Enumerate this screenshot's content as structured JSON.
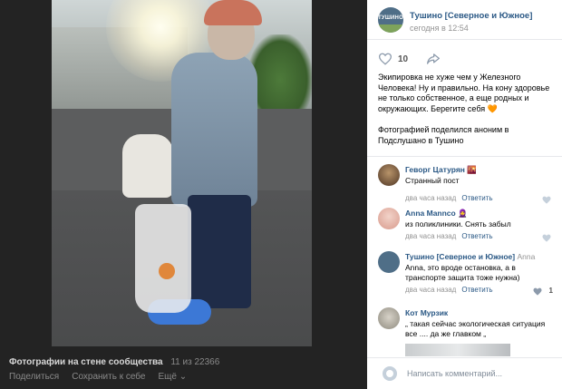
{
  "viewer": {
    "footer_title": "Фотографии на стене сообщества",
    "footer_count": "11 из 22366",
    "actions": [
      "Поделиться",
      "Сохранить к себе",
      "Ещё ⌄"
    ]
  },
  "post": {
    "group_name": "Тушино [Северное и Южное]",
    "avatar_text": "ТУШИНО",
    "time": "сегодня в 12:54",
    "likes": "10",
    "text": "Экипировка не хуже чем у Железного Человека! Ну и правильно. На кону здоровье не только собственное, а еще родных и окружающих. Берегите себя",
    "text_emoji": "🧡",
    "text2": "Фотографией поделился аноним в Подслушано в Тушино"
  },
  "comments": [
    {
      "author": "Геворг Цатурян",
      "author_emoji": "🌇",
      "author_extra": "",
      "text": "Странный пост",
      "time": "два часа назад",
      "reply": "Ответить"
    },
    {
      "author": "Anna Mannco",
      "author_emoji": "🧕",
      "author_extra": "",
      "text": "из поликлиники. Снять забыл",
      "time": "два часа назад",
      "reply": "Ответить"
    },
    {
      "author": "Тушино [Северное и Южное]",
      "author_emoji": "",
      "author_extra": " Anna",
      "text": "Anna, это вроде остановка, а в транспорте защита тоже нужна)",
      "time": "два часа назад",
      "reply": "Ответить",
      "count": "1"
    },
    {
      "author": "Кот Мурзик",
      "author_emoji": "",
      "author_extra": "",
      "text": "„ такая сейчас экологическая ситуация все .... да же главком „",
      "time": "",
      "reply": ""
    }
  ],
  "composer": {
    "placeholder": "Написать комментарий..."
  },
  "colors": {
    "link": "#2a5885",
    "muted": "#939393",
    "viewer_bg": "#232323"
  }
}
